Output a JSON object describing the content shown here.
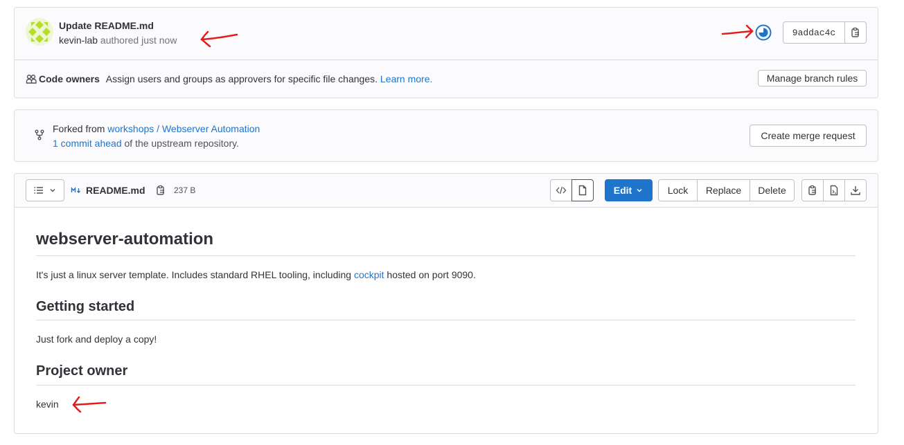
{
  "commit": {
    "title": "Update README.md",
    "author": "kevin-lab",
    "authored_text": "authored just now",
    "sha": "9addac4c"
  },
  "code_owners": {
    "label": "Code owners",
    "description": "Assign users and groups as approvers for specific file changes.",
    "learn_more": "Learn more.",
    "manage_button": "Manage branch rules"
  },
  "fork": {
    "prefix": "Forked from",
    "source": "workshops / Webserver Automation",
    "ahead_link": "1 commit ahead",
    "ahead_suffix": "of the upstream repository.",
    "merge_button": "Create merge request"
  },
  "file": {
    "name": "README.md",
    "size": "237 B",
    "edit_button": "Edit",
    "lock_button": "Lock",
    "replace_button": "Replace",
    "delete_button": "Delete"
  },
  "readme": {
    "h1": "webserver-automation",
    "p1_before": "It's just a linux server template. Includes standard RHEL tooling, including",
    "p1_link": "cockpit",
    "p1_after": "hosted on port 9090.",
    "h2_getting_started": "Getting started",
    "p2": "Just fork and deploy a copy!",
    "h2_owner": "Project owner",
    "p3": "kevin"
  },
  "colors": {
    "link": "#1f75cb",
    "primary_button": "#1f75cb",
    "annotation_arrow": "#e11d1d",
    "avatar": "#c5e84a"
  }
}
